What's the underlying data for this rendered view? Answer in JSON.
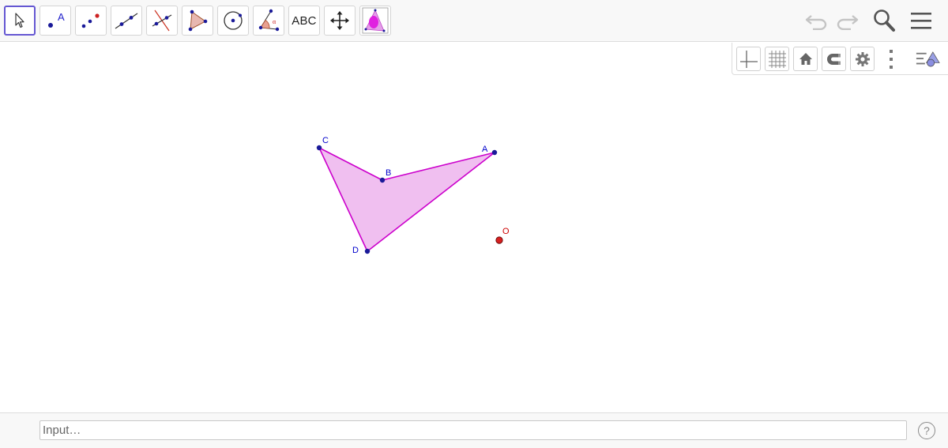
{
  "toolbar": {
    "tools": [
      {
        "name": "move-tool",
        "icon": "cursor-arrow-icon"
      },
      {
        "name": "point-tool",
        "icon": "point-icon",
        "label": "A"
      },
      {
        "name": "point-on-object-tool",
        "icon": "points-icon"
      },
      {
        "name": "line-tool",
        "icon": "line-through-points-icon"
      },
      {
        "name": "perpendicular-line-tool",
        "icon": "perpendicular-line-icon"
      },
      {
        "name": "polygon-tool",
        "icon": "polygon-icon"
      },
      {
        "name": "circle-tool",
        "icon": "circle-center-point-icon"
      },
      {
        "name": "angle-tool",
        "icon": "angle-icon",
        "label": "α"
      },
      {
        "name": "text-tool",
        "icon": "text-icon",
        "label": "ABC"
      },
      {
        "name": "move-graphics-view-tool",
        "icon": "move-graphics-icon"
      },
      {
        "name": "custom-tool",
        "icon": "custom-triangle-icon"
      }
    ],
    "undo_icon": "undo-icon",
    "redo_icon": "redo-icon",
    "search_icon": "search-icon",
    "menu_icon": "hamburger-menu-icon"
  },
  "stylebar": {
    "buttons": [
      "axes-icon",
      "grid-icon",
      "home-icon",
      "magnet-icon",
      "gear-icon",
      "more-vert-icon",
      "view-menu-icon"
    ]
  },
  "graphics": {
    "points": [
      {
        "label": "C",
        "color": "#0000cc"
      },
      {
        "label": "B",
        "color": "#0000cc"
      },
      {
        "label": "A",
        "color": "#0000cc"
      },
      {
        "label": "D",
        "color": "#0000cc"
      },
      {
        "label": "O",
        "color": "#cc0000"
      }
    ],
    "polygon": {
      "vertices": [
        "C",
        "B",
        "A",
        "D"
      ],
      "stroke": "#cc00cc",
      "fill": "#f0bff0"
    }
  },
  "input_bar": {
    "placeholder": "Input…",
    "help_label": "?"
  },
  "colors": {
    "accent": "#6557d2",
    "point_blue": "#0000cc",
    "point_red": "#cc0000"
  }
}
